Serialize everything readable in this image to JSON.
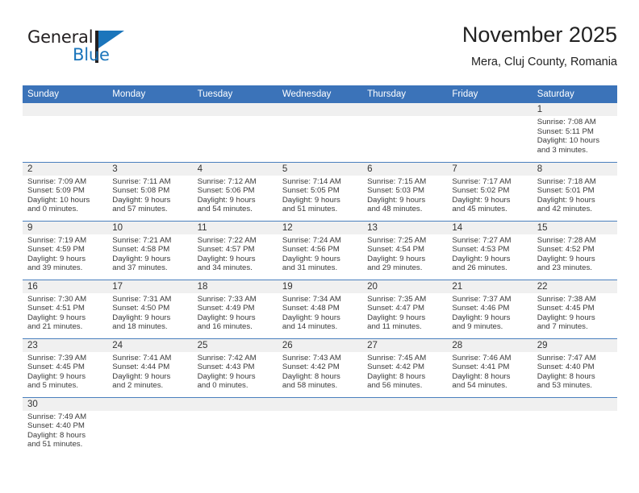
{
  "brand": {
    "name_part1": "General",
    "name_part2": "Blue",
    "logo_icon": "triangle-flag-icon"
  },
  "header": {
    "title": "November 2025",
    "subtitle": "Mera, Cluj County, Romania"
  },
  "colors": {
    "header_blue": "#3b73b9",
    "row_divider": "#4a7fbe",
    "daynum_band": "#f0f0f0",
    "brand_blue": "#1b75bb",
    "text": "#222222"
  },
  "weekdays": [
    {
      "label": "Sunday"
    },
    {
      "label": "Monday"
    },
    {
      "label": "Tuesday"
    },
    {
      "label": "Wednesday"
    },
    {
      "label": "Thursday"
    },
    {
      "label": "Friday"
    },
    {
      "label": "Saturday"
    }
  ],
  "weeks": [
    [
      {
        "day": "",
        "sunrise": "",
        "sunset": "",
        "daylight_line1": "",
        "daylight_line2": "",
        "empty": true
      },
      {
        "day": "",
        "sunrise": "",
        "sunset": "",
        "daylight_line1": "",
        "daylight_line2": "",
        "empty": true
      },
      {
        "day": "",
        "sunrise": "",
        "sunset": "",
        "daylight_line1": "",
        "daylight_line2": "",
        "empty": true
      },
      {
        "day": "",
        "sunrise": "",
        "sunset": "",
        "daylight_line1": "",
        "daylight_line2": "",
        "empty": true
      },
      {
        "day": "",
        "sunrise": "",
        "sunset": "",
        "daylight_line1": "",
        "daylight_line2": "",
        "empty": true
      },
      {
        "day": "",
        "sunrise": "",
        "sunset": "",
        "daylight_line1": "",
        "daylight_line2": "",
        "empty": true
      },
      {
        "day": "1",
        "sunrise": "Sunrise: 7:08 AM",
        "sunset": "Sunset: 5:11 PM",
        "daylight_line1": "Daylight: 10 hours",
        "daylight_line2": "and 3 minutes.",
        "empty": false
      }
    ],
    [
      {
        "day": "2",
        "sunrise": "Sunrise: 7:09 AM",
        "sunset": "Sunset: 5:09 PM",
        "daylight_line1": "Daylight: 10 hours",
        "daylight_line2": "and 0 minutes.",
        "empty": false
      },
      {
        "day": "3",
        "sunrise": "Sunrise: 7:11 AM",
        "sunset": "Sunset: 5:08 PM",
        "daylight_line1": "Daylight: 9 hours",
        "daylight_line2": "and 57 minutes.",
        "empty": false
      },
      {
        "day": "4",
        "sunrise": "Sunrise: 7:12 AM",
        "sunset": "Sunset: 5:06 PM",
        "daylight_line1": "Daylight: 9 hours",
        "daylight_line2": "and 54 minutes.",
        "empty": false
      },
      {
        "day": "5",
        "sunrise": "Sunrise: 7:14 AM",
        "sunset": "Sunset: 5:05 PM",
        "daylight_line1": "Daylight: 9 hours",
        "daylight_line2": "and 51 minutes.",
        "empty": false
      },
      {
        "day": "6",
        "sunrise": "Sunrise: 7:15 AM",
        "sunset": "Sunset: 5:03 PM",
        "daylight_line1": "Daylight: 9 hours",
        "daylight_line2": "and 48 minutes.",
        "empty": false
      },
      {
        "day": "7",
        "sunrise": "Sunrise: 7:17 AM",
        "sunset": "Sunset: 5:02 PM",
        "daylight_line1": "Daylight: 9 hours",
        "daylight_line2": "and 45 minutes.",
        "empty": false
      },
      {
        "day": "8",
        "sunrise": "Sunrise: 7:18 AM",
        "sunset": "Sunset: 5:01 PM",
        "daylight_line1": "Daylight: 9 hours",
        "daylight_line2": "and 42 minutes.",
        "empty": false
      }
    ],
    [
      {
        "day": "9",
        "sunrise": "Sunrise: 7:19 AM",
        "sunset": "Sunset: 4:59 PM",
        "daylight_line1": "Daylight: 9 hours",
        "daylight_line2": "and 39 minutes.",
        "empty": false
      },
      {
        "day": "10",
        "sunrise": "Sunrise: 7:21 AM",
        "sunset": "Sunset: 4:58 PM",
        "daylight_line1": "Daylight: 9 hours",
        "daylight_line2": "and 37 minutes.",
        "empty": false
      },
      {
        "day": "11",
        "sunrise": "Sunrise: 7:22 AM",
        "sunset": "Sunset: 4:57 PM",
        "daylight_line1": "Daylight: 9 hours",
        "daylight_line2": "and 34 minutes.",
        "empty": false
      },
      {
        "day": "12",
        "sunrise": "Sunrise: 7:24 AM",
        "sunset": "Sunset: 4:56 PM",
        "daylight_line1": "Daylight: 9 hours",
        "daylight_line2": "and 31 minutes.",
        "empty": false
      },
      {
        "day": "13",
        "sunrise": "Sunrise: 7:25 AM",
        "sunset": "Sunset: 4:54 PM",
        "daylight_line1": "Daylight: 9 hours",
        "daylight_line2": "and 29 minutes.",
        "empty": false
      },
      {
        "day": "14",
        "sunrise": "Sunrise: 7:27 AM",
        "sunset": "Sunset: 4:53 PM",
        "daylight_line1": "Daylight: 9 hours",
        "daylight_line2": "and 26 minutes.",
        "empty": false
      },
      {
        "day": "15",
        "sunrise": "Sunrise: 7:28 AM",
        "sunset": "Sunset: 4:52 PM",
        "daylight_line1": "Daylight: 9 hours",
        "daylight_line2": "and 23 minutes.",
        "empty": false
      }
    ],
    [
      {
        "day": "16",
        "sunrise": "Sunrise: 7:30 AM",
        "sunset": "Sunset: 4:51 PM",
        "daylight_line1": "Daylight: 9 hours",
        "daylight_line2": "and 21 minutes.",
        "empty": false
      },
      {
        "day": "17",
        "sunrise": "Sunrise: 7:31 AM",
        "sunset": "Sunset: 4:50 PM",
        "daylight_line1": "Daylight: 9 hours",
        "daylight_line2": "and 18 minutes.",
        "empty": false
      },
      {
        "day": "18",
        "sunrise": "Sunrise: 7:33 AM",
        "sunset": "Sunset: 4:49 PM",
        "daylight_line1": "Daylight: 9 hours",
        "daylight_line2": "and 16 minutes.",
        "empty": false
      },
      {
        "day": "19",
        "sunrise": "Sunrise: 7:34 AM",
        "sunset": "Sunset: 4:48 PM",
        "daylight_line1": "Daylight: 9 hours",
        "daylight_line2": "and 14 minutes.",
        "empty": false
      },
      {
        "day": "20",
        "sunrise": "Sunrise: 7:35 AM",
        "sunset": "Sunset: 4:47 PM",
        "daylight_line1": "Daylight: 9 hours",
        "daylight_line2": "and 11 minutes.",
        "empty": false
      },
      {
        "day": "21",
        "sunrise": "Sunrise: 7:37 AM",
        "sunset": "Sunset: 4:46 PM",
        "daylight_line1": "Daylight: 9 hours",
        "daylight_line2": "and 9 minutes.",
        "empty": false
      },
      {
        "day": "22",
        "sunrise": "Sunrise: 7:38 AM",
        "sunset": "Sunset: 4:45 PM",
        "daylight_line1": "Daylight: 9 hours",
        "daylight_line2": "and 7 minutes.",
        "empty": false
      }
    ],
    [
      {
        "day": "23",
        "sunrise": "Sunrise: 7:39 AM",
        "sunset": "Sunset: 4:45 PM",
        "daylight_line1": "Daylight: 9 hours",
        "daylight_line2": "and 5 minutes.",
        "empty": false
      },
      {
        "day": "24",
        "sunrise": "Sunrise: 7:41 AM",
        "sunset": "Sunset: 4:44 PM",
        "daylight_line1": "Daylight: 9 hours",
        "daylight_line2": "and 2 minutes.",
        "empty": false
      },
      {
        "day": "25",
        "sunrise": "Sunrise: 7:42 AM",
        "sunset": "Sunset: 4:43 PM",
        "daylight_line1": "Daylight: 9 hours",
        "daylight_line2": "and 0 minutes.",
        "empty": false
      },
      {
        "day": "26",
        "sunrise": "Sunrise: 7:43 AM",
        "sunset": "Sunset: 4:42 PM",
        "daylight_line1": "Daylight: 8 hours",
        "daylight_line2": "and 58 minutes.",
        "empty": false
      },
      {
        "day": "27",
        "sunrise": "Sunrise: 7:45 AM",
        "sunset": "Sunset: 4:42 PM",
        "daylight_line1": "Daylight: 8 hours",
        "daylight_line2": "and 56 minutes.",
        "empty": false
      },
      {
        "day": "28",
        "sunrise": "Sunrise: 7:46 AM",
        "sunset": "Sunset: 4:41 PM",
        "daylight_line1": "Daylight: 8 hours",
        "daylight_line2": "and 54 minutes.",
        "empty": false
      },
      {
        "day": "29",
        "sunrise": "Sunrise: 7:47 AM",
        "sunset": "Sunset: 4:40 PM",
        "daylight_line1": "Daylight: 8 hours",
        "daylight_line2": "and 53 minutes.",
        "empty": false
      }
    ],
    [
      {
        "day": "30",
        "sunrise": "Sunrise: 7:49 AM",
        "sunset": "Sunset: 4:40 PM",
        "daylight_line1": "Daylight: 8 hours",
        "daylight_line2": "and 51 minutes.",
        "empty": false
      },
      {
        "day": "",
        "sunrise": "",
        "sunset": "",
        "daylight_line1": "",
        "daylight_line2": "",
        "empty": true
      },
      {
        "day": "",
        "sunrise": "",
        "sunset": "",
        "daylight_line1": "",
        "daylight_line2": "",
        "empty": true
      },
      {
        "day": "",
        "sunrise": "",
        "sunset": "",
        "daylight_line1": "",
        "daylight_line2": "",
        "empty": true
      },
      {
        "day": "",
        "sunrise": "",
        "sunset": "",
        "daylight_line1": "",
        "daylight_line2": "",
        "empty": true
      },
      {
        "day": "",
        "sunrise": "",
        "sunset": "",
        "daylight_line1": "",
        "daylight_line2": "",
        "empty": true
      },
      {
        "day": "",
        "sunrise": "",
        "sunset": "",
        "daylight_line1": "",
        "daylight_line2": "",
        "empty": true
      }
    ]
  ]
}
